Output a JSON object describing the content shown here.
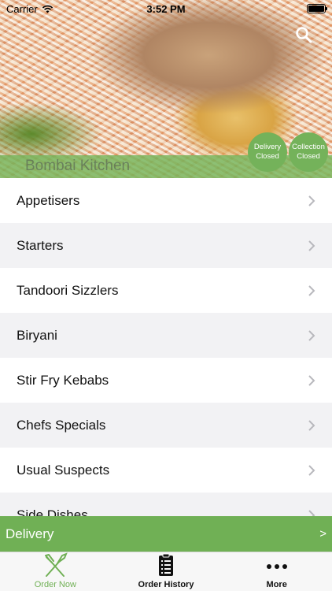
{
  "status_bar": {
    "carrier": "Carrier",
    "time": "3:52 PM"
  },
  "header": {
    "restaurant_name": "Bombai Kitchen",
    "search_icon": "search-icon",
    "badges": {
      "delivery": [
        "Delivery",
        "Closed"
      ],
      "collection": [
        "Collection",
        "Closed"
      ]
    }
  },
  "menu": {
    "items": [
      "Appetisers",
      "Starters",
      "Tandoori Sizzlers",
      "Biryani",
      "Stir Fry Kebabs",
      "Chefs Specials",
      "Usual Suspects",
      "Side Dishes"
    ]
  },
  "delivery_bar": {
    "label": "Delivery",
    "arrow": ">"
  },
  "tab_bar": {
    "tabs": [
      {
        "label": "Order Now",
        "icon": "fork-knife-icon",
        "active": true
      },
      {
        "label": "Order History",
        "icon": "clipboard-list-icon",
        "active": false
      },
      {
        "label": "More",
        "icon": "more-dots-icon",
        "active": false
      }
    ]
  },
  "colors": {
    "brand_green": "#70b055",
    "list_alt_bg": "#f2f2f4"
  }
}
